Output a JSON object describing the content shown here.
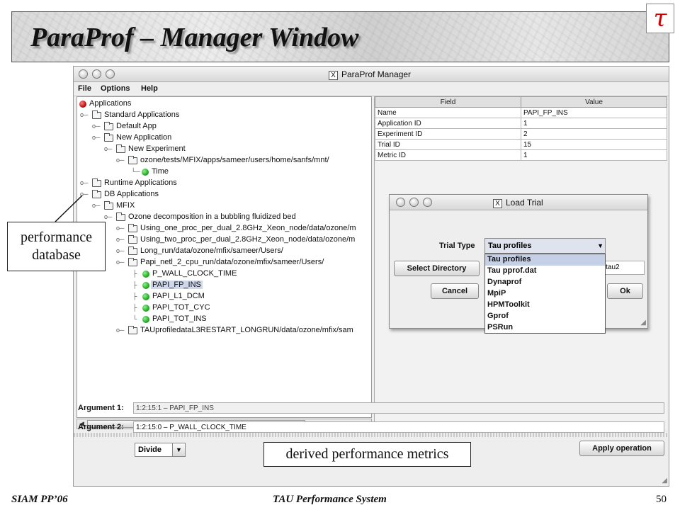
{
  "slide": {
    "title": "ParaProf  – Manager Window",
    "logo_glyph": "τ",
    "footer_left": "SIAM PP’06",
    "footer_center": "TAU Performance System",
    "page_number": "50",
    "callout_perf_line1": "performance",
    "callout_perf_line2": "database",
    "callout_derived": "derived performance metrics"
  },
  "window": {
    "title": "ParaProf Manager",
    "x_icon": "X",
    "menu": [
      "File",
      "Options",
      "Help"
    ]
  },
  "tree": [
    {
      "label": "Applications",
      "icon": "red-dot"
    },
    {
      "label": "Standard Applications",
      "icon": "folder"
    },
    {
      "label": "Default App",
      "icon": "folder"
    },
    {
      "label": "New Application",
      "icon": "folder"
    },
    {
      "label": "New Experiment",
      "icon": "folder"
    },
    {
      "label": "ozone/tests/MFIX/apps/sameer/users/home/sanfs/mnt/",
      "icon": "folder"
    },
    {
      "label": "Time",
      "icon": "green-dot"
    },
    {
      "label": "Runtime Applications",
      "icon": "folder"
    },
    {
      "label": "DB Applications",
      "icon": "folder"
    },
    {
      "label": "MFIX",
      "icon": "folder"
    },
    {
      "label": "Ozone decomposition in a bubbling fluidized bed",
      "icon": "folder"
    },
    {
      "label": "Using_one_proc_per_dual_2.8GHz_Xeon_node/data/ozone/m",
      "icon": "folder"
    },
    {
      "label": "Using_two_proc_per_dual_2.8GHz_Xeon_node/data/ozone/m",
      "icon": "folder"
    },
    {
      "label": "Long_run/data/ozone/mfix/sameer/Users/",
      "icon": "folder"
    },
    {
      "label": "Papi_netl_2_cpu_run/data/ozone/mfix/sameer/Users/",
      "icon": "folder"
    },
    {
      "label": "P_WALL_CLOCK_TIME",
      "icon": "green-dot"
    },
    {
      "label": "PAPI_FP_INS",
      "icon": "green-dot",
      "selected": true
    },
    {
      "label": "PAPI_L1_DCM",
      "icon": "green-dot"
    },
    {
      "label": "PAPI_TOT_CYC",
      "icon": "green-dot"
    },
    {
      "label": "PAPI_TOT_INS",
      "icon": "green-dot"
    },
    {
      "label": "TAUprofiledataL3RESTART_LONGRUN/data/ozone/mfix/sam",
      "icon": "folder"
    }
  ],
  "table": {
    "headers": [
      "Field",
      "Value"
    ],
    "rows": [
      [
        "Name",
        "PAPI_FP_INS"
      ],
      [
        "Application ID",
        "1"
      ],
      [
        "Experiment ID",
        "2"
      ],
      [
        "Trial ID",
        "15"
      ],
      [
        "Metric ID",
        "1"
      ]
    ]
  },
  "derived": {
    "arg1_label": "Argument 1:",
    "arg1_value": "1:2:15:1 – PAPI_FP_INS",
    "arg2_label": "Argument 2:",
    "arg2_value": "1:2:15:0 – P_WALL_CLOCK_TIME",
    "operation": "Divide",
    "apply_label": "Apply operation"
  },
  "dialog": {
    "title": "Load Trial",
    "trial_type_label": "Trial Type",
    "trial_type_value": "Tau profiles",
    "select_dir_label": "Select Directory",
    "path_value": "r/tau2",
    "cancel_label": "Cancel",
    "ok_label": "Ok",
    "options": [
      "Tau profiles",
      "Tau pprof.dat",
      "Dynaprof",
      "MpiP",
      "HPMToolkit",
      "Gprof",
      "PSRun"
    ]
  }
}
